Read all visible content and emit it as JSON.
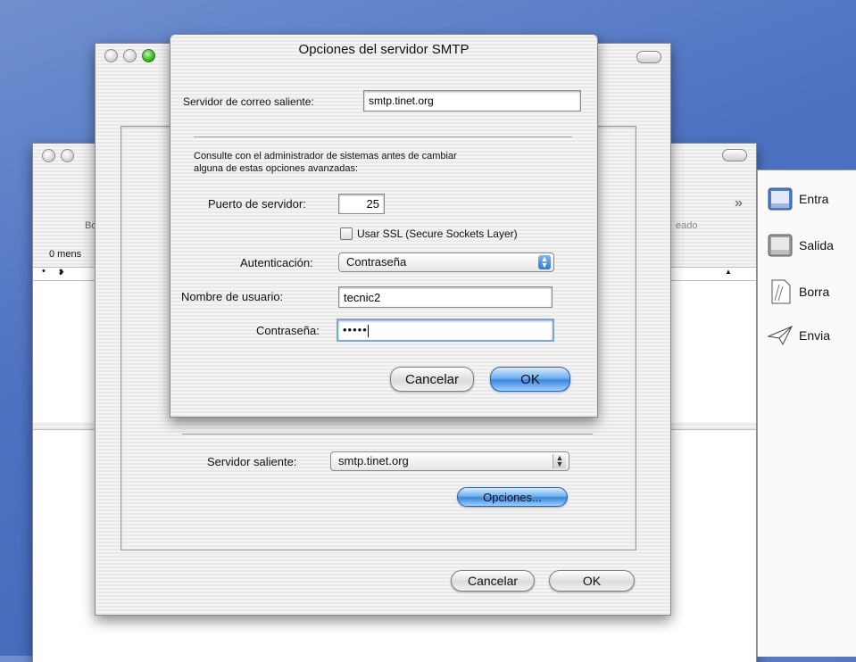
{
  "mail_window": {
    "partial_labels": {
      "left_toolbar": "Bo",
      "messages_count": "0 mens",
      "right_toolbar": "eado"
    },
    "overflow_chevron": "»"
  },
  "mailbox_drawer": {
    "items": [
      {
        "label": "Entra",
        "icon": "inbox-tray-icon"
      },
      {
        "label": "Salida",
        "icon": "outbox-tray-icon"
      },
      {
        "label": "Borra",
        "icon": "drafts-page-icon"
      },
      {
        "label": "Envia",
        "icon": "paper-plane-icon"
      }
    ]
  },
  "account_sheet": {
    "outgoing_server_label": "Servidor saliente:",
    "outgoing_server_value": "smtp.tinet.org",
    "options_button": "Opciones...",
    "cancel_button": "Cancelar",
    "ok_button": "OK"
  },
  "smtp_dialog": {
    "title": "Opciones del servidor SMTP",
    "server_label": "Servidor de correo saliente:",
    "server_value": "smtp.tinet.org",
    "advice_line1": "Consulte con el administrador de sistemas antes de cambiar",
    "advice_line2": "alguna de estas opciones avanzadas:",
    "port_label": "Puerto de servidor:",
    "port_value": "25",
    "ssl_label": "Usar SSL (Secure Sockets Layer)",
    "ssl_checked": false,
    "auth_label": "Autenticación:",
    "auth_value": "Contraseña",
    "username_label": "Nombre de usuario:",
    "username_value": "tecnic2",
    "password_label": "Contraseña:",
    "password_value": "•••••",
    "cancel_button": "Cancelar",
    "ok_button": "OK"
  }
}
